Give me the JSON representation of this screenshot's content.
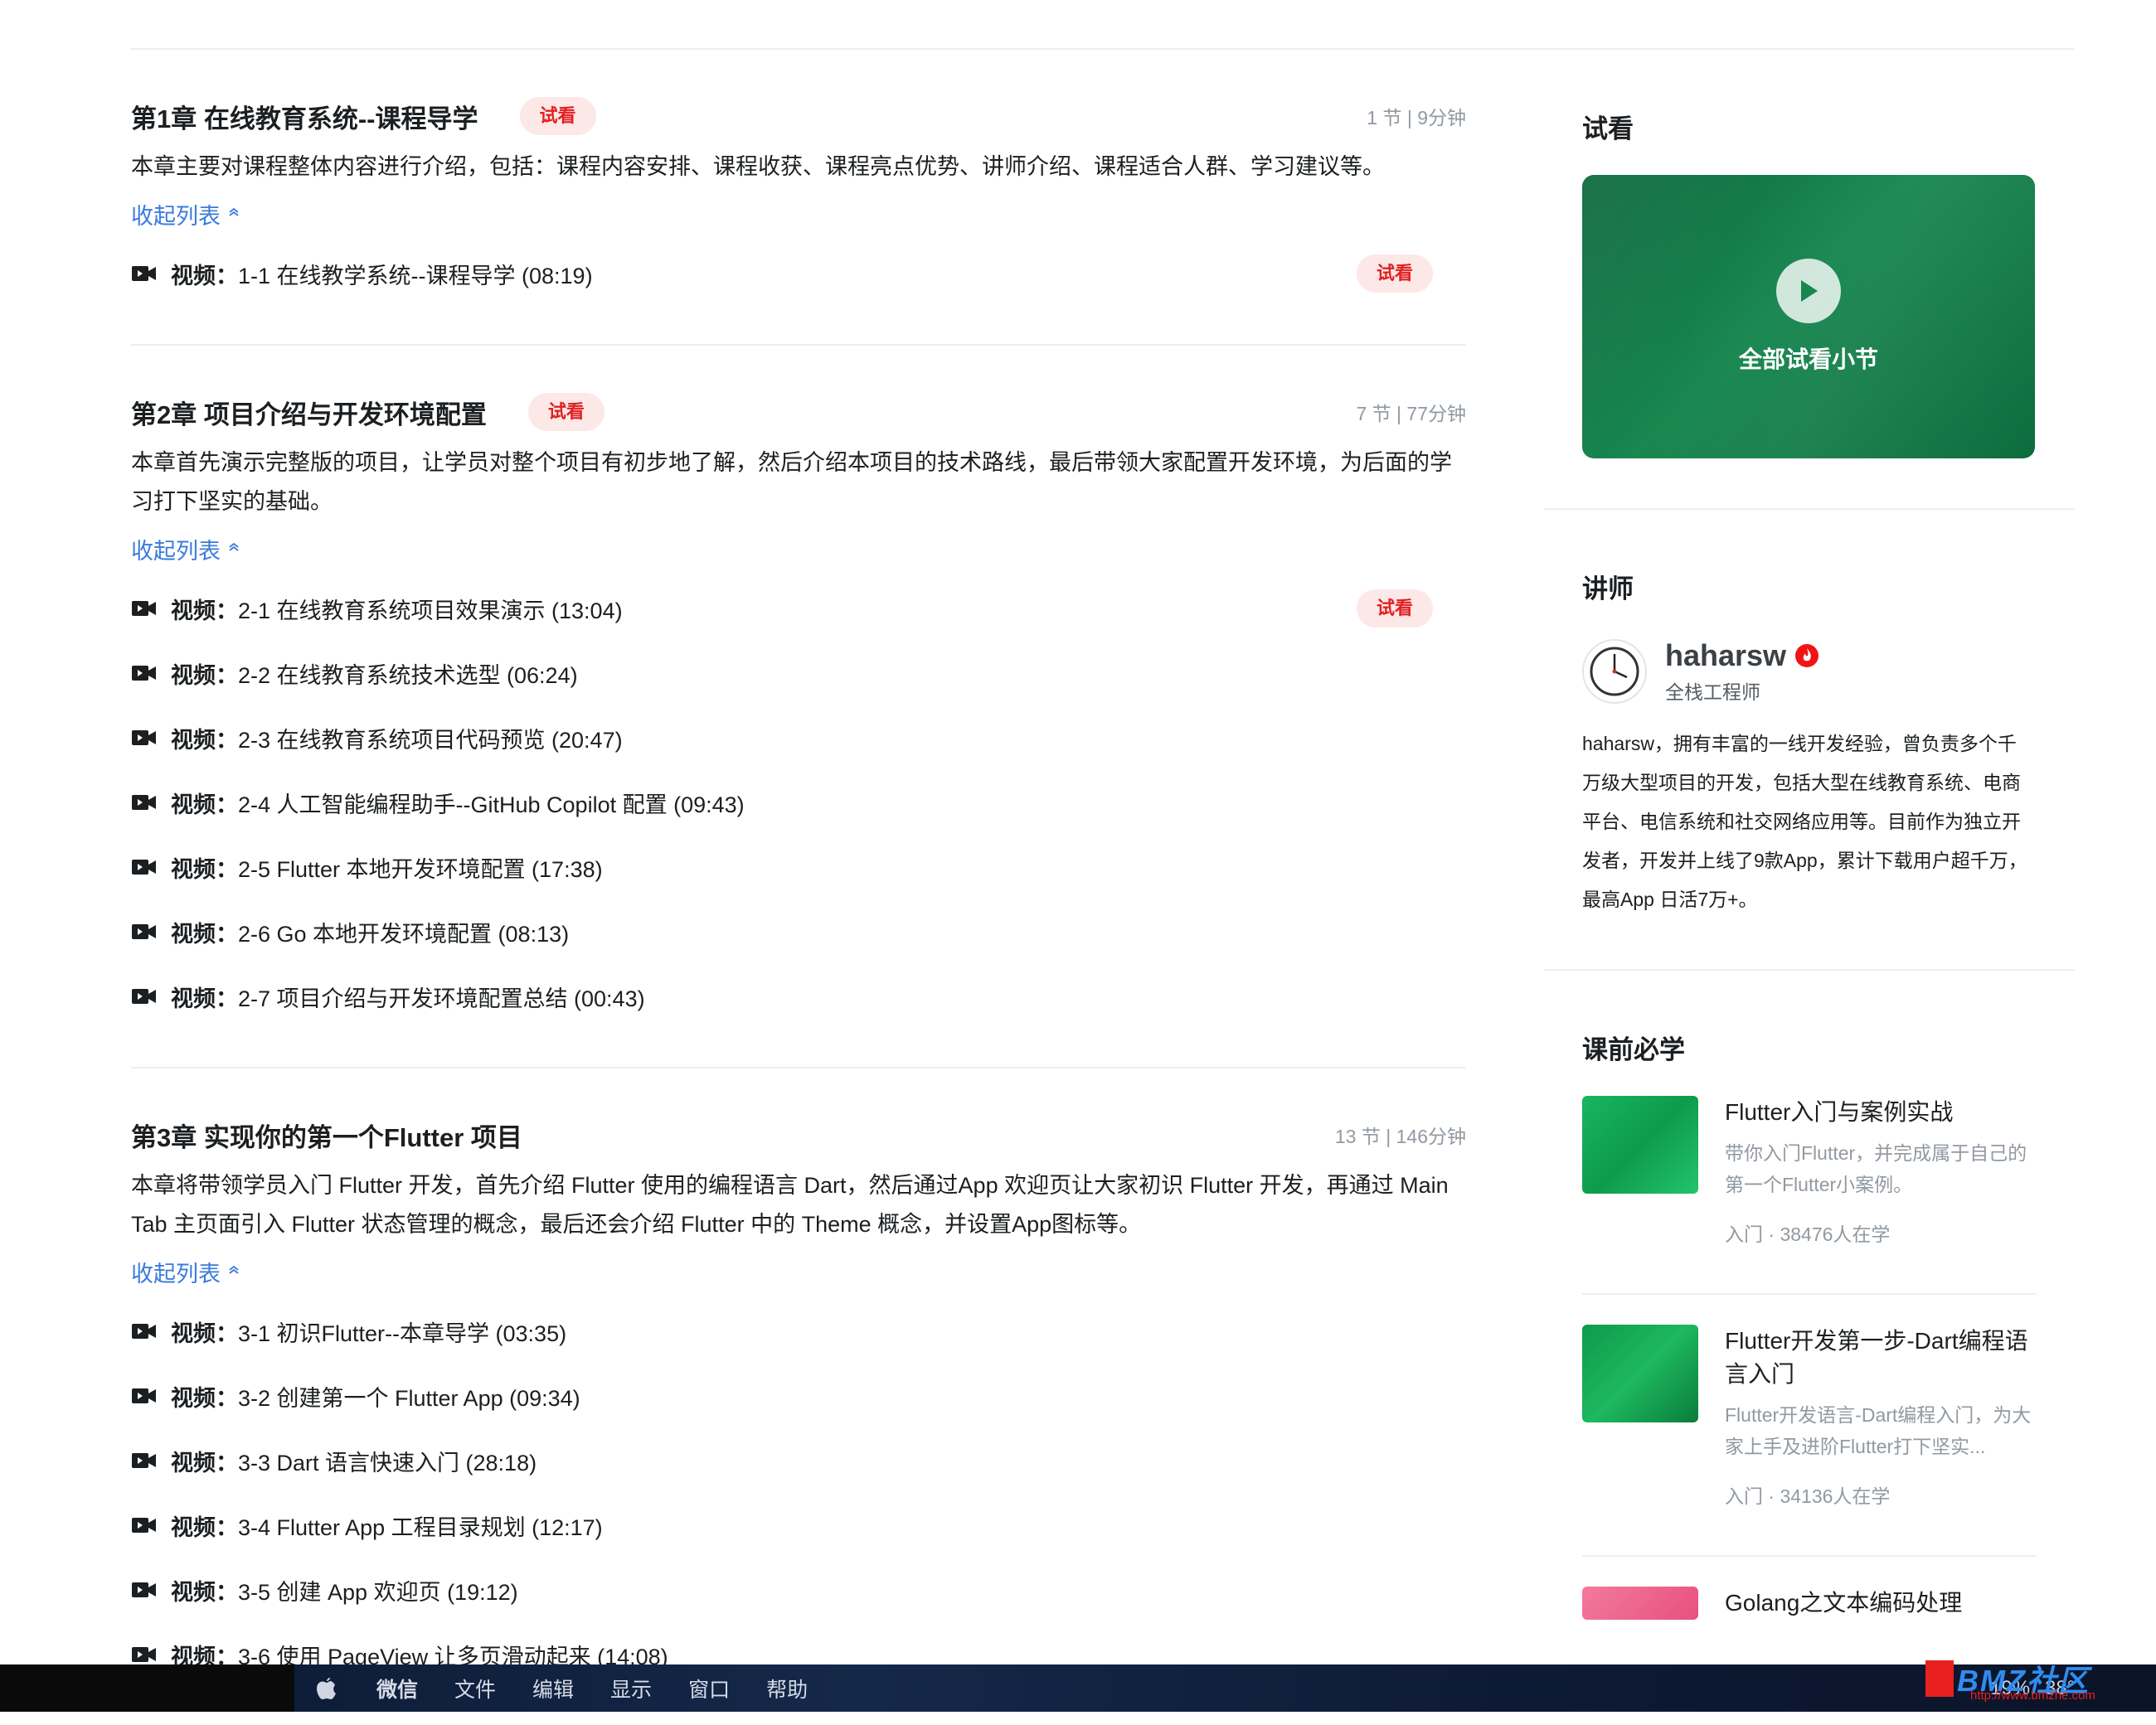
{
  "chapters": [
    {
      "title": "第1章 在线教育系统--课程导学",
      "tag": "试看",
      "meta": "1 节 | 9分钟",
      "desc": "本章主要对课程整体内容进行介绍，包括：课程内容安排、课程收获、课程亮点优势、讲师介绍、课程适合人群、学习建议等。",
      "collapse_label": "收起列表",
      "lessons": [
        {
          "type": "视频：",
          "title": "1-1 在线教学系统--课程导学 (08:19)",
          "tag": "试看"
        }
      ]
    },
    {
      "title": "第2章 项目介绍与开发环境配置",
      "tag": "试看",
      "meta": "7 节 | 77分钟",
      "desc": "本章首先演示完整版的项目，让学员对整个项目有初步地了解，然后介绍本项目的技术路线，最后带领大家配置开发环境，为后面的学习打下坚实的基础。",
      "collapse_label": "收起列表",
      "lessons": [
        {
          "type": "视频：",
          "title": "2-1 在线教育系统项目效果演示 (13:04)",
          "tag": "试看"
        },
        {
          "type": "视频：",
          "title": "2-2 在线教育系统技术选型 (06:24)"
        },
        {
          "type": "视频：",
          "title": "2-3 在线教育系统项目代码预览 (20:47)"
        },
        {
          "type": "视频：",
          "title": "2-4 人工智能编程助手--GitHub Copilot 配置 (09:43)"
        },
        {
          "type": "视频：",
          "title": "2-5 Flutter 本地开发环境配置 (17:38)"
        },
        {
          "type": "视频：",
          "title": "2-6 Go 本地开发环境配置 (08:13)"
        },
        {
          "type": "视频：",
          "title": "2-7 项目介绍与开发环境配置总结 (00:43)"
        }
      ]
    },
    {
      "title": "第3章 实现你的第一个Flutter 项目",
      "meta": "13 节 | 146分钟",
      "desc": "本章将带领学员入门 Flutter 开发，首先介绍 Flutter 使用的编程语言 Dart，然后通过App 欢迎页让大家初识 Flutter 开发，再通过 Main Tab 主页面引入 Flutter 状态管理的概念，最后还会介绍 Flutter 中的 Theme 概念，并设置App图标等。",
      "collapse_label": "收起列表",
      "lessons": [
        {
          "type": "视频：",
          "title": "3-1 初识Flutter--本章导学 (03:35)"
        },
        {
          "type": "视频：",
          "title": "3-2 创建第一个 Flutter App (09:34)"
        },
        {
          "type": "视频：",
          "title": "3-3 Dart 语言快速入门 (28:18)"
        },
        {
          "type": "视频：",
          "title": "3-4 Flutter App 工程目录规划 (12:17)"
        },
        {
          "type": "视频：",
          "title": "3-5 创建 App 欢迎页 (19:12)"
        },
        {
          "type": "视频：",
          "title": "3-6 使用 PageView 让多页滑动起来 (14:08)"
        }
      ]
    }
  ],
  "sidebar": {
    "trial": {
      "heading": "试看",
      "card_label": "全部试看小节",
      "play_icon": "play-icon"
    },
    "teacher": {
      "heading": "讲师",
      "name": "haharsw",
      "role": "全栈工程师",
      "bio": "haharsw，拥有丰富的一线开发经验，曾负责多个千万级大型项目的开发，包括大型在线教育系统、电商平台、电信系统和社交网络应用等。目前作为独立开发者，开发并上线了9款App，累计下载用户超千万，最高App 日活7万+。",
      "badge_icon": "fire-badge-icon"
    },
    "prereq": {
      "heading": "课前必学",
      "courses": [
        {
          "title": "Flutter入门与案例实战",
          "desc": "带你入门Flutter，并完成属于自己的第一个Flutter小案例。",
          "meta": "入门 · 38476人在学"
        },
        {
          "title": "Flutter开发第一步-Dart编程语言入门",
          "desc": "Flutter开发语言-Dart编程入门，为大家上手及进阶Flutter打下坚实...",
          "meta": "入门 · 34136人在学"
        },
        {
          "title": "Golang之文本编码处理"
        }
      ]
    }
  },
  "menubar": {
    "items": [
      "微信",
      "文件",
      "编辑",
      "显示",
      "窗口",
      "帮助"
    ],
    "tray": [
      "19%",
      "38°"
    ]
  },
  "watermark": {
    "text": "BMZ社区",
    "url": "http://www.bmzhe.com"
  },
  "colors": {
    "accent_blue": "#3a7bdc",
    "try_red": "#e02020",
    "try_bg": "#fde8e8",
    "card_green": "#17864f"
  }
}
